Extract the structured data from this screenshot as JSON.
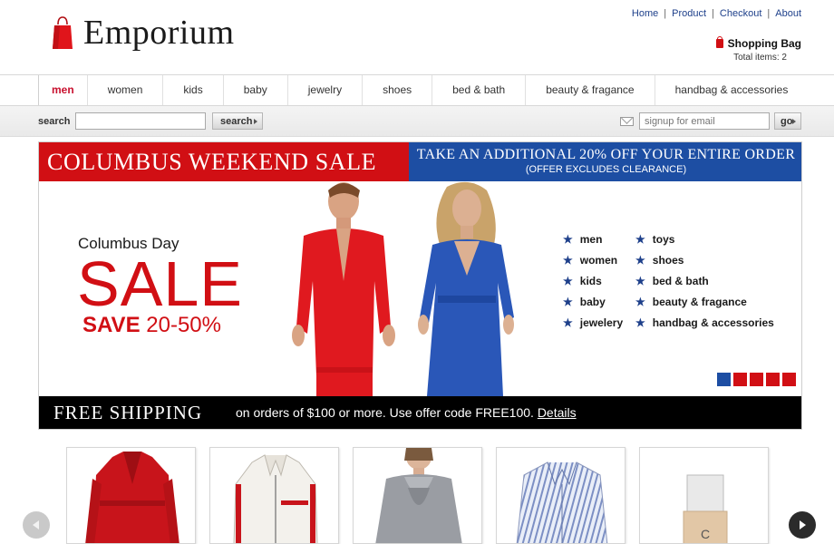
{
  "header": {
    "logo_text": "Emporium",
    "top_links": [
      "Home",
      "Product",
      "Checkout",
      "About"
    ],
    "bag_label": "Shopping Bag",
    "total_items": "Total items: 2"
  },
  "nav": {
    "items": [
      "men",
      "women",
      "kids",
      "baby",
      "jewelry",
      "shoes",
      "bed & bath",
      "beauty & fragance",
      "handbag & accessories"
    ],
    "active": "men"
  },
  "search": {
    "label": "search",
    "value": "",
    "button": "search",
    "email_placeholder": "signup for email",
    "go_button": "go"
  },
  "banner": {
    "sale_headline": "COLUMBUS WEEKEND SALE",
    "offer_line1": "TAKE AN ADDITIONAL 20% OFF YOUR ENTIRE ORDER",
    "offer_line2": "(OFFER EXCLUDES CLEARANCE)",
    "columbus_day": "Columbus Day",
    "sale": "SALE",
    "save_word": "SAVE",
    "save_range": "20-50%",
    "categories_left": [
      "men",
      "women",
      "kids",
      "baby",
      "jewelery"
    ],
    "categories_right": [
      "toys",
      "shoes",
      "bed & bath",
      "beauty & fragance",
      "handbag & accessories"
    ],
    "slide_dots": [
      "#1d4ea3",
      "#d10f14",
      "#d10f14",
      "#d10f14",
      "#d10f14"
    ],
    "free_shipping_title": "FREE SHIPPING",
    "free_shipping_text": "on orders of $100 or more. Use offer code FREE100.",
    "details_link": "Details"
  },
  "products": {
    "items": [
      "red-trench-coat",
      "white-leather-jacket",
      "gray-drape-top",
      "striped-dress-shirt",
      "foundation-bottle"
    ]
  },
  "colors": {
    "brand_red": "#d10f14",
    "brand_blue": "#1d4ea3",
    "link_blue": "#1d3f8a"
  }
}
